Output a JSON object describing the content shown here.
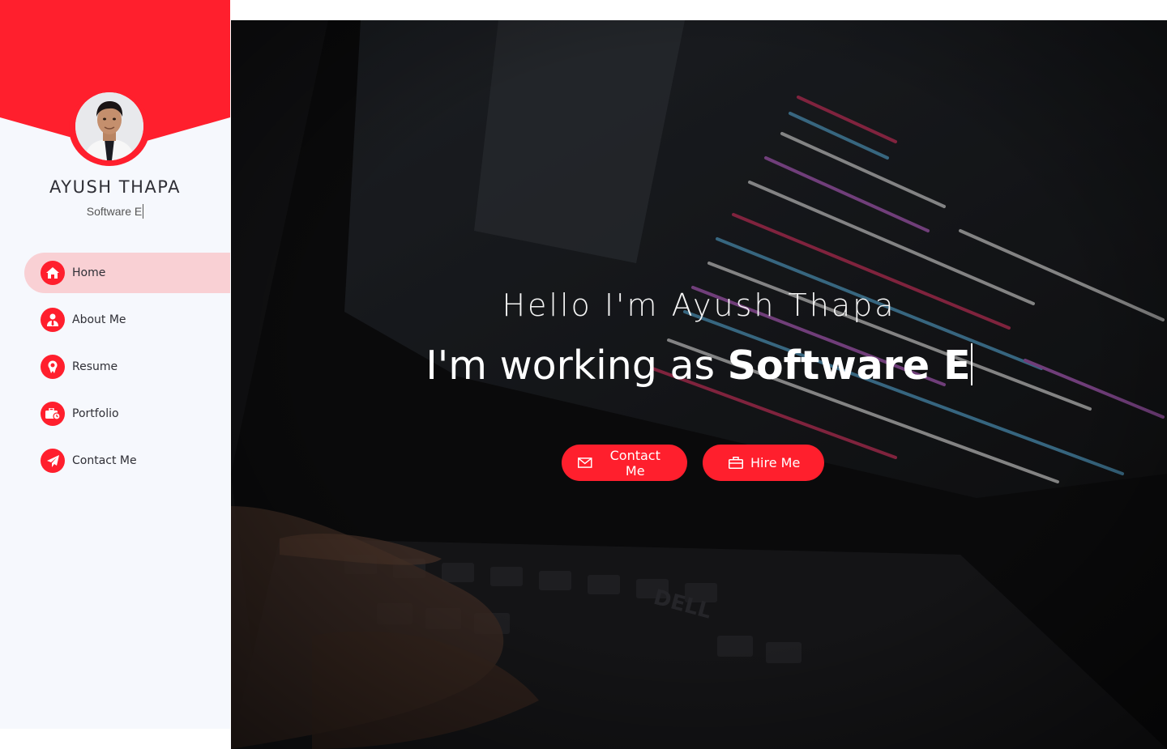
{
  "profile": {
    "name": "AYUSH THAPA",
    "role_typed": "Software E"
  },
  "sidebar": {
    "items": [
      {
        "label": "Home",
        "icon": "home-icon",
        "active": true
      },
      {
        "label": "About Me",
        "icon": "user-tie-icon",
        "active": false
      },
      {
        "label": "Resume",
        "icon": "award-icon",
        "active": false
      },
      {
        "label": "Portfolio",
        "icon": "briefcase-clock-icon",
        "active": false
      },
      {
        "label": "Contact Me",
        "icon": "paper-plane-icon",
        "active": false
      }
    ]
  },
  "hero": {
    "hello": "Hello I'm Ayush Thapa",
    "working_prefix": "I'm working as ",
    "working_typed": "Software E",
    "buttons": {
      "contact": "Contact Me",
      "hire": "Hire Me"
    }
  },
  "colors": {
    "accent": "#ff1f2d",
    "active_bg": "#f9d0d4",
    "sidebar_bg": "#f6f8fd"
  }
}
